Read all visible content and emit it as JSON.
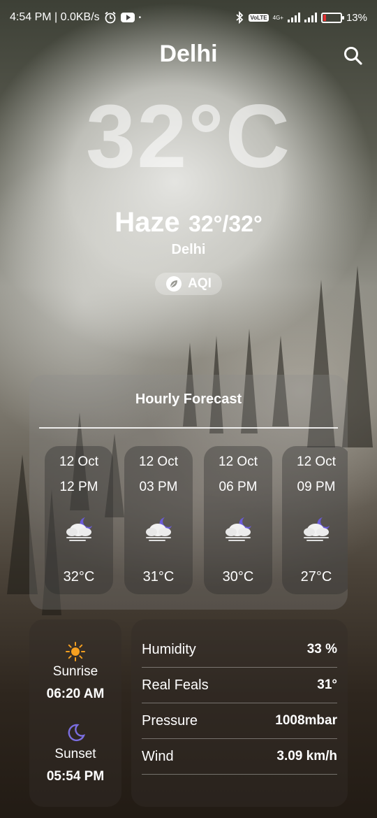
{
  "status_bar": {
    "time_speed": "4:54 PM | 0.0KB/s",
    "battery": "13%",
    "network_badge": "4G+",
    "volte_badge": "VoLTE"
  },
  "header": {
    "city": "Delhi",
    "temperature": "32°C"
  },
  "condition": {
    "name": "Haze",
    "range": "32°/32°",
    "location": "Delhi",
    "aqi_label": "AQI"
  },
  "hourly": {
    "title": "Hourly Forecast",
    "items": [
      {
        "date": "12 Oct",
        "time": "12 PM",
        "temp": "32°C",
        "icon": "night-cloud-icon"
      },
      {
        "date": "12 Oct",
        "time": "03 PM",
        "temp": "31°C",
        "icon": "night-cloud-icon"
      },
      {
        "date": "12 Oct",
        "time": "06 PM",
        "temp": "30°C",
        "icon": "night-cloud-icon"
      },
      {
        "date": "12 Oct",
        "time": "09 PM",
        "temp": "27°C",
        "icon": "night-cloud-icon"
      }
    ]
  },
  "sun": {
    "sunrise_label": "Sunrise",
    "sunrise_time": "06:20 AM",
    "sunset_label": "Sunset",
    "sunset_time": "05:54 PM"
  },
  "details": [
    {
      "label": "Humidity",
      "value": "33 %"
    },
    {
      "label": "Real Feals",
      "value": "31°"
    },
    {
      "label": "Pressure",
      "value": "1008mbar"
    },
    {
      "label": "Wind",
      "value": "3.09 km/h"
    }
  ],
  "colors": {
    "sun_accent": "#f5a020",
    "moon_accent": "#7b6ee0"
  }
}
